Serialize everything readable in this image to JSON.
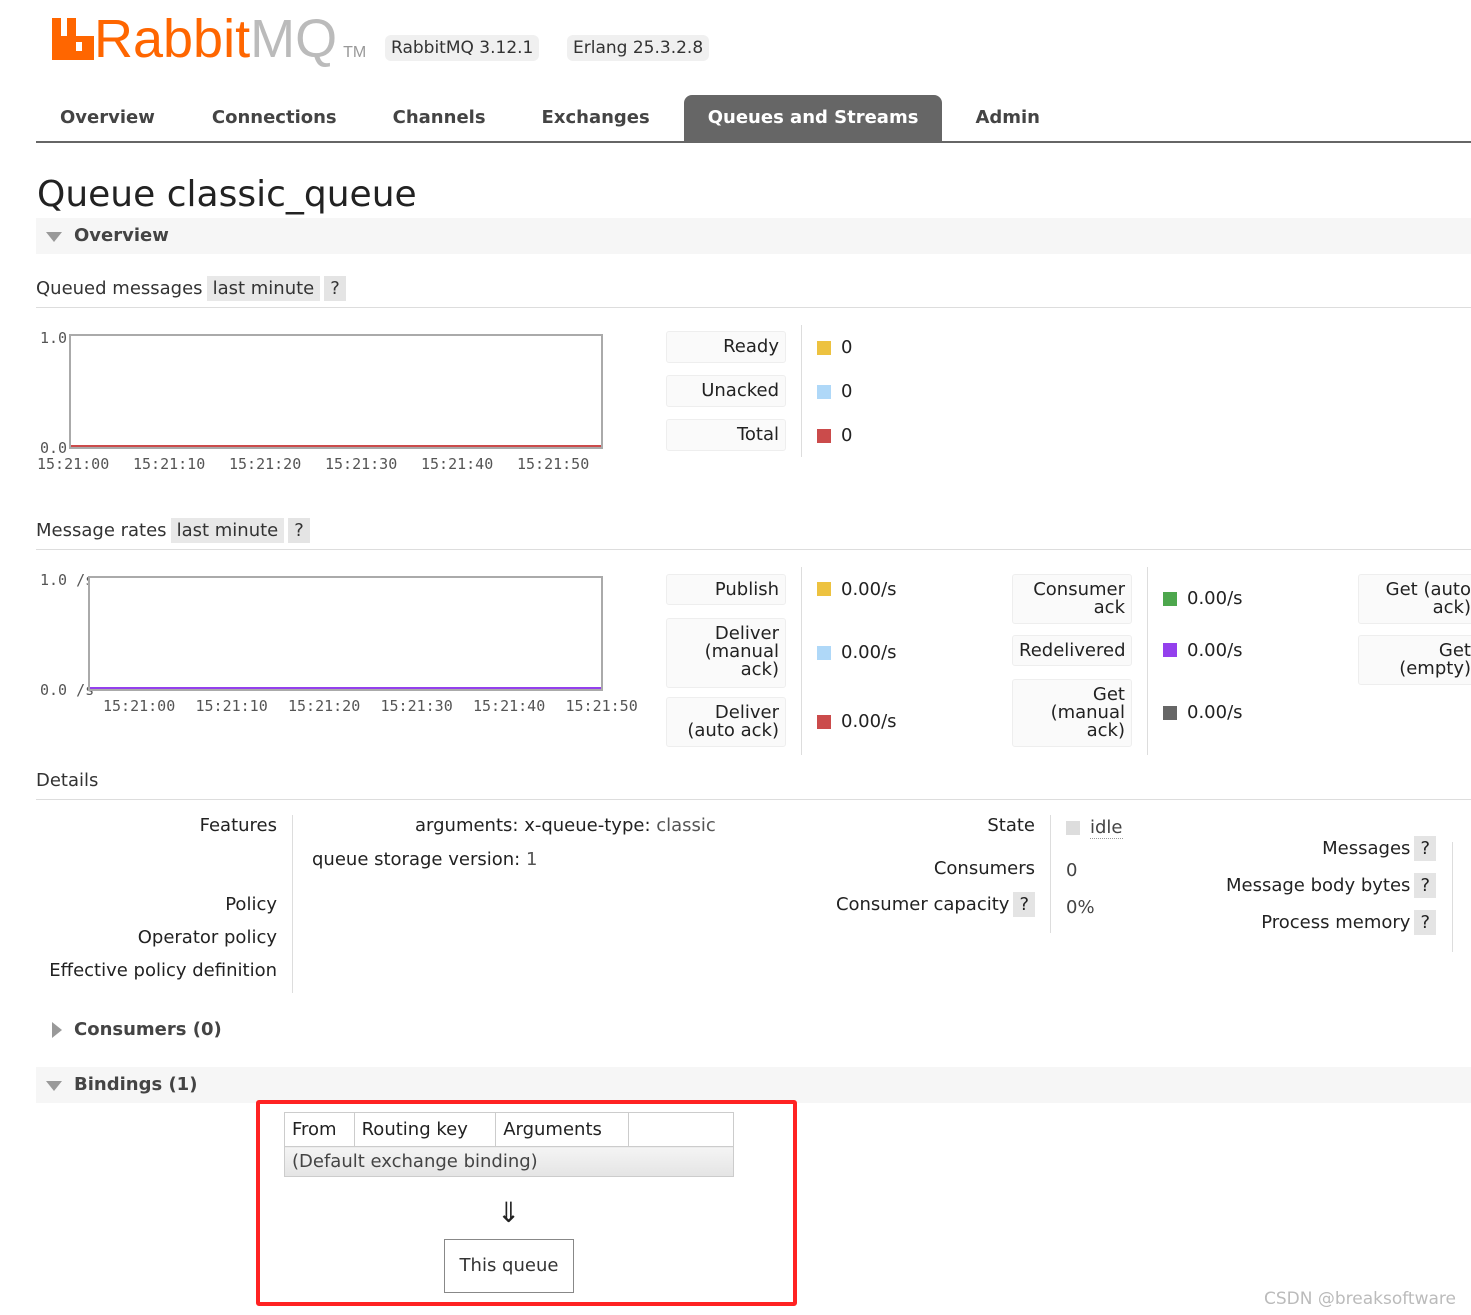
{
  "header": {
    "logo_part1": "RabbitMQ",
    "logo_rabbit": "Rabbit",
    "logo_mq": "MQ",
    "logo_tm": "TM",
    "version": "RabbitMQ 3.12.1",
    "erlang": "Erlang 25.3.2.8"
  },
  "nav": [
    "Overview",
    "Connections",
    "Channels",
    "Exchanges",
    "Queues and Streams",
    "Admin"
  ],
  "nav_active": "Queues and Streams",
  "page_title": "Queue classic_queue",
  "overview_section": "Overview",
  "queued": {
    "title": "Queued messages",
    "range": "last minute",
    "help": "?",
    "stats": [
      {
        "label": "Ready",
        "value": "0",
        "color": "#edc240"
      },
      {
        "label": "Unacked",
        "value": "0",
        "color": "#afd8f8"
      },
      {
        "label": "Total",
        "value": "0",
        "color": "#cb4b4b"
      }
    ]
  },
  "rates": {
    "title": "Message rates",
    "range": "last minute",
    "help": "?",
    "col1": [
      {
        "label": "Publish",
        "value": "0.00/s",
        "color": "#edc240"
      },
      {
        "label": "Deliver (manual ack)",
        "value": "0.00/s",
        "color": "#afd8f8"
      },
      {
        "label": "Deliver (auto ack)",
        "value": "0.00/s",
        "color": "#cb4b4b"
      }
    ],
    "col2": [
      {
        "label": "Consumer ack",
        "value": "0.00/s",
        "color": "#4da74d"
      },
      {
        "label": "Redelivered",
        "value": "0.00/s",
        "color": "#9440ed"
      },
      {
        "label": "Get (manual ack)",
        "value": "0.00/s",
        "color": "#666666"
      }
    ],
    "col3": [
      {
        "label": "Get (auto ack)"
      },
      {
        "label": "Get (empty)"
      }
    ]
  },
  "chart_data": [
    {
      "type": "line",
      "ylim": [
        0,
        1
      ],
      "yticks": [
        "1.0",
        "0.0"
      ],
      "xticks": [
        "15:21:00",
        "15:21:10",
        "15:21:20",
        "15:21:30",
        "15:21:40",
        "15:21:50"
      ],
      "series": [
        {
          "name": "Total",
          "color": "#cb4b4b",
          "values": [
            0,
            0,
            0,
            0,
            0,
            0
          ]
        }
      ]
    },
    {
      "type": "line",
      "ylim": [
        0,
        1
      ],
      "yticks": [
        "1.0 /s",
        "0.0 /s"
      ],
      "xticks": [
        "15:21:00",
        "15:21:10",
        "15:21:20",
        "15:21:30",
        "15:21:40",
        "15:21:50"
      ],
      "series": [
        {
          "name": "Redelivered",
          "color": "#9440ed",
          "values": [
            0,
            0,
            0,
            0,
            0,
            0
          ]
        }
      ]
    }
  ],
  "details": {
    "title": "Details",
    "features": "Features",
    "arg_key": "arguments:",
    "arg_sub": "x-queue-type:",
    "arg_val": "classic",
    "storage_key": "queue storage version:",
    "storage_val": "1",
    "policy": "Policy",
    "op_policy": "Operator policy",
    "eff_policy": "Effective policy definition",
    "state": "State",
    "state_val": "idle",
    "consumers": "Consumers",
    "consumers_val": "0",
    "capacity": "Consumer capacity",
    "capacity_val": "0%",
    "help": "?",
    "messages": "Messages",
    "body_bytes": "Message body bytes",
    "proc_mem": "Process memory"
  },
  "consumers_section": "Consumers (0)",
  "bindings_section": "Bindings (1)",
  "bindings": {
    "headers": [
      "From",
      "Routing key",
      "Arguments"
    ],
    "row": "(Default exchange binding)",
    "arrow": "⇓",
    "this_queue": "This queue"
  },
  "watermark": "CSDN @breaksoftware"
}
